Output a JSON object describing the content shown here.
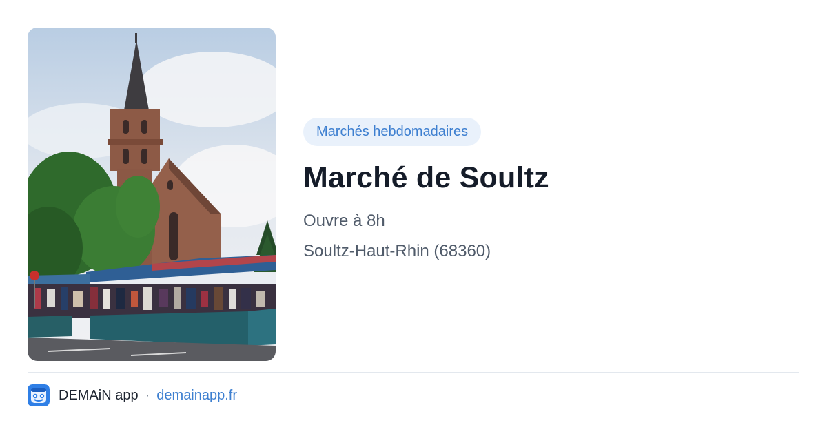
{
  "event": {
    "category": "Marchés hebdomadaires",
    "title": "Marché de Soultz",
    "hours": "Ouvre à 8h",
    "location": "Soultz-Haut-Rhin (68360)"
  },
  "photo": {
    "subject": "church-and-market-photo"
  },
  "footer": {
    "app_name": "DEMAiN app",
    "separator": "·",
    "link_text": "demainapp.fr",
    "app_icon": "demain-app-logo-icon"
  },
  "colors": {
    "accent": "#3d7fd0",
    "badge_bg": "#e9f1fb",
    "title": "#151c29",
    "meta_text": "#505b6a",
    "divider": "#e3e8ee",
    "app_icon_bg": "#2f7fe6"
  }
}
